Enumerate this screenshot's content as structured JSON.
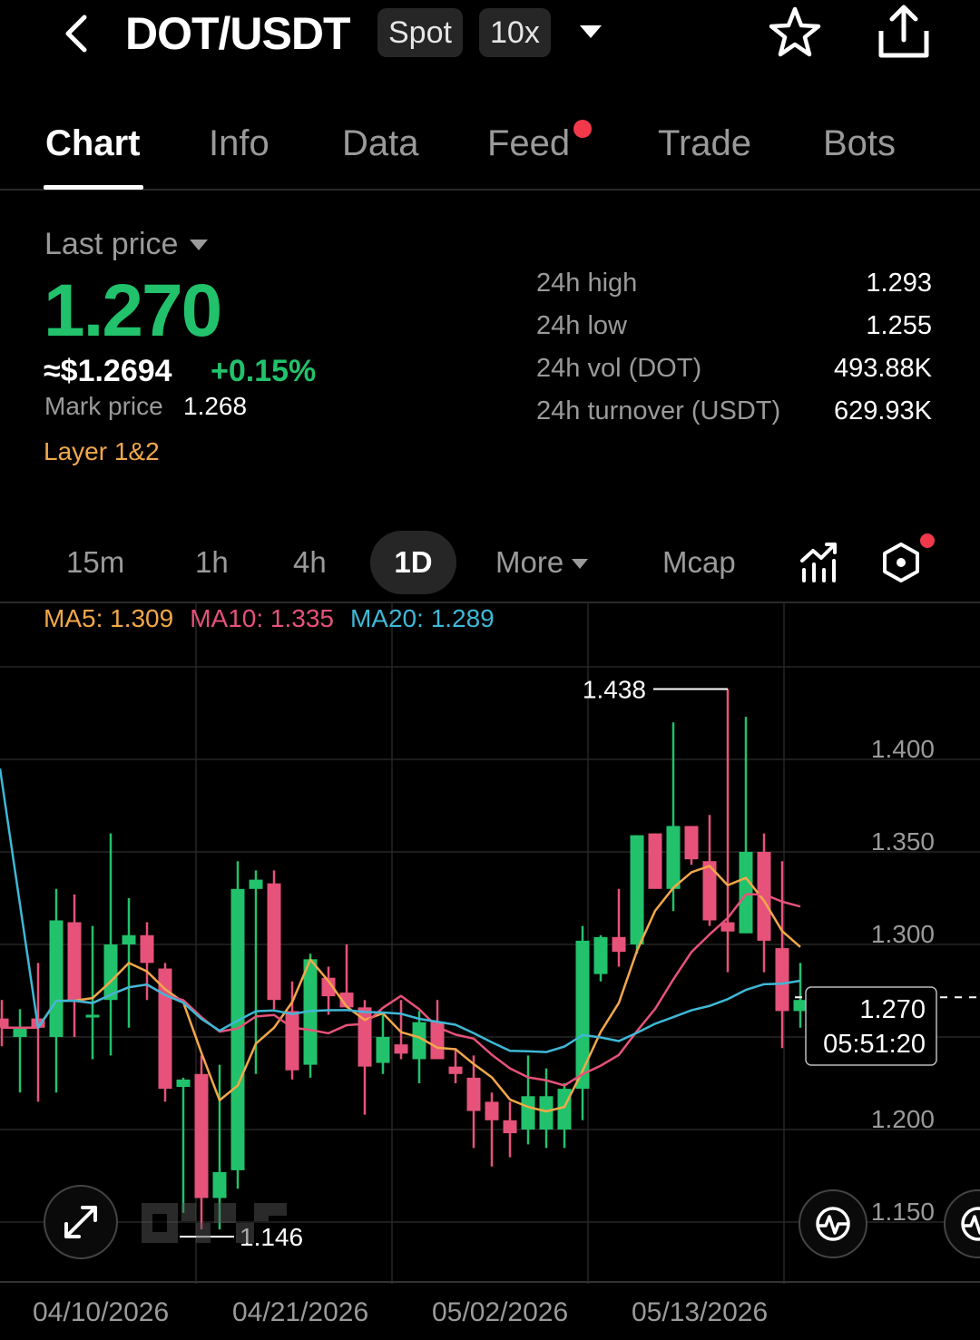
{
  "header": {
    "pair": "DOT/USDT",
    "market_type": "Spot",
    "leverage": "10x"
  },
  "tabs": [
    "Chart",
    "Info",
    "Data",
    "Feed",
    "Trade",
    "Bots"
  ],
  "price": {
    "label": "Last price",
    "last": "1.270",
    "approx_usd": "≈$1.2694",
    "change": "+0.15%",
    "mark_label": "Mark price",
    "mark_value": "1.268",
    "tag": "Layer 1&2"
  },
  "stats": [
    {
      "label": "24h high",
      "value": "1.293"
    },
    {
      "label": "24h low",
      "value": "1.255"
    },
    {
      "label": "24h vol (DOT)",
      "value": "493.88K"
    },
    {
      "label": "24h turnover (USDT)",
      "value": "629.93K"
    }
  ],
  "timeframes": {
    "items": [
      "15m",
      "1h",
      "4h"
    ],
    "active": "1D",
    "more": "More",
    "mcap": "Mcap"
  },
  "ma": {
    "ma5": "MA5: 1.309",
    "ma10": "MA10: 1.335",
    "ma20": "MA20: 1.289"
  },
  "colors": {
    "up": "#21c26b",
    "down": "#e6527a",
    "ma5": "#f2a84a",
    "ma10": "#e6527a",
    "ma20": "#3fb8d6"
  },
  "chart_data": {
    "type": "candlestick",
    "y_ticks": [
      "1.400",
      "1.350",
      "1.300",
      "1.200",
      "1.150"
    ],
    "x_ticks": [
      "04/10/2026",
      "04/21/2026",
      "05/02/2026",
      "05/13/2026"
    ],
    "ylim": [
      1.12,
      1.47
    ],
    "grid": true,
    "high_marker": "1.438",
    "low_marker": "1.146",
    "current_price_label": "1.270",
    "countdown": "05:51:20",
    "candles": [
      {
        "o": 1.26,
        "h": 1.27,
        "l": 1.245,
        "c": 1.255
      },
      {
        "o": 1.25,
        "h": 1.265,
        "l": 1.22,
        "c": 1.255
      },
      {
        "o": 1.26,
        "h": 1.29,
        "l": 1.215,
        "c": 1.255
      },
      {
        "o": 1.25,
        "h": 1.33,
        "l": 1.22,
        "c": 1.313
      },
      {
        "o": 1.312,
        "h": 1.327,
        "l": 1.25,
        "c": 1.27
      },
      {
        "o": 1.262,
        "h": 1.31,
        "l": 1.238,
        "c": 1.262
      },
      {
        "o": 1.27,
        "h": 1.36,
        "l": 1.24,
        "c": 1.3
      },
      {
        "o": 1.3,
        "h": 1.325,
        "l": 1.255,
        "c": 1.305
      },
      {
        "o": 1.305,
        "h": 1.312,
        "l": 1.27,
        "c": 1.29
      },
      {
        "o": 1.287,
        "h": 1.29,
        "l": 1.215,
        "c": 1.222
      },
      {
        "o": 1.223,
        "h": 1.228,
        "l": 1.155,
        "c": 1.227
      },
      {
        "o": 1.23,
        "h": 1.24,
        "l": 1.146,
        "c": 1.163
      },
      {
        "o": 1.163,
        "h": 1.235,
        "l": 1.146,
        "c": 1.177
      },
      {
        "o": 1.178,
        "h": 1.345,
        "l": 1.168,
        "c": 1.33
      },
      {
        "o": 1.33,
        "h": 1.34,
        "l": 1.23,
        "c": 1.335
      },
      {
        "o": 1.333,
        "h": 1.34,
        "l": 1.265,
        "c": 1.27
      },
      {
        "o": 1.264,
        "h": 1.28,
        "l": 1.227,
        "c": 1.232
      },
      {
        "o": 1.235,
        "h": 1.295,
        "l": 1.228,
        "c": 1.292
      },
      {
        "o": 1.282,
        "h": 1.288,
        "l": 1.262,
        "c": 1.272
      },
      {
        "o": 1.274,
        "h": 1.3,
        "l": 1.27,
        "c": 1.266
      },
      {
        "o": 1.266,
        "h": 1.27,
        "l": 1.208,
        "c": 1.234
      },
      {
        "o": 1.236,
        "h": 1.262,
        "l": 1.23,
        "c": 1.25
      },
      {
        "o": 1.246,
        "h": 1.27,
        "l": 1.238,
        "c": 1.241
      },
      {
        "o": 1.238,
        "h": 1.264,
        "l": 1.225,
        "c": 1.258
      },
      {
        "o": 1.258,
        "h": 1.27,
        "l": 1.24,
        "c": 1.238
      },
      {
        "o": 1.234,
        "h": 1.244,
        "l": 1.225,
        "c": 1.23
      },
      {
        "o": 1.228,
        "h": 1.24,
        "l": 1.19,
        "c": 1.21
      },
      {
        "o": 1.215,
        "h": 1.22,
        "l": 1.18,
        "c": 1.205
      },
      {
        "o": 1.205,
        "h": 1.215,
        "l": 1.185,
        "c": 1.198
      },
      {
        "o": 1.2,
        "h": 1.24,
        "l": 1.192,
        "c": 1.218
      },
      {
        "o": 1.2,
        "h": 1.233,
        "l": 1.19,
        "c": 1.218
      },
      {
        "o": 1.2,
        "h": 1.225,
        "l": 1.19,
        "c": 1.222
      },
      {
        "o": 1.222,
        "h": 1.31,
        "l": 1.205,
        "c": 1.302
      },
      {
        "o": 1.284,
        "h": 1.305,
        "l": 1.28,
        "c": 1.304
      },
      {
        "o": 1.304,
        "h": 1.33,
        "l": 1.288,
        "c": 1.296
      },
      {
        "o": 1.3,
        "h": 1.359,
        "l": 1.295,
        "c": 1.359
      },
      {
        "o": 1.36,
        "h": 1.36,
        "l": 1.335,
        "c": 1.33
      },
      {
        "o": 1.33,
        "h": 1.42,
        "l": 1.318,
        "c": 1.364
      },
      {
        "o": 1.364,
        "h": 1.36,
        "l": 1.343,
        "c": 1.346
      },
      {
        "o": 1.345,
        "h": 1.37,
        "l": 1.31,
        "c": 1.313
      },
      {
        "o": 1.312,
        "h": 1.438,
        "l": 1.285,
        "c": 1.307
      },
      {
        "o": 1.306,
        "h": 1.423,
        "l": 1.307,
        "c": 1.35
      },
      {
        "o": 1.35,
        "h": 1.36,
        "l": 1.285,
        "c": 1.302
      },
      {
        "o": 1.298,
        "h": 1.345,
        "l": 1.244,
        "c": 1.264
      },
      {
        "o": 1.264,
        "h": 1.29,
        "l": 1.255,
        "c": 1.27
      }
    ]
  }
}
